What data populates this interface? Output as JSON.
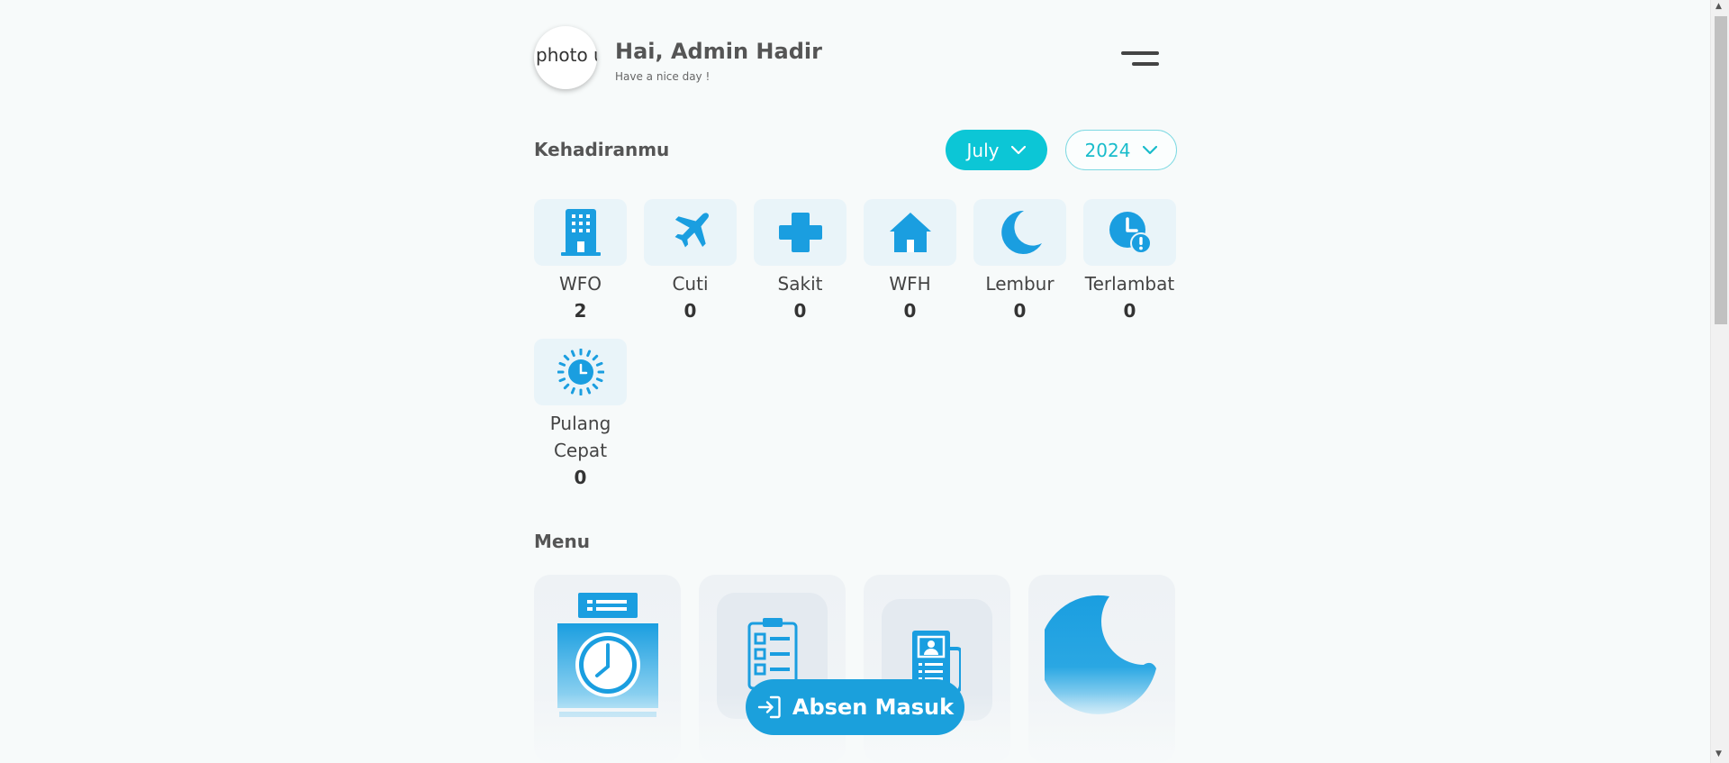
{
  "header": {
    "avatar_alt": "photo user",
    "greeting": "Hai, Admin Hadir",
    "subtitle": "Have a nice day !"
  },
  "attendance": {
    "title": "Kehadiranmu",
    "month": "July",
    "year": "2024",
    "stats": [
      {
        "label": "WFO",
        "value": "2",
        "icon": "office-building-icon"
      },
      {
        "label": "Cuti",
        "value": "0",
        "icon": "airplane-icon"
      },
      {
        "label": "Sakit",
        "value": "0",
        "icon": "medical-cross-icon"
      },
      {
        "label": "WFH",
        "value": "0",
        "icon": "home-icon"
      },
      {
        "label": "Lembur",
        "value": "0",
        "icon": "moon-icon"
      },
      {
        "label": "Terlambat",
        "value": "0",
        "icon": "clock-alert-icon"
      },
      {
        "label": "Pulang Cepat",
        "value": "0",
        "icon": "sun-clock-icon"
      }
    ]
  },
  "menu": {
    "title": "Menu",
    "items": [
      {
        "icon": "time-clock-machine-icon"
      },
      {
        "icon": "clipboard-checklist-icon"
      },
      {
        "icon": "document-profile-icon"
      },
      {
        "icon": "moon-icon"
      }
    ]
  },
  "absen_button": {
    "label": "Absen Masuk",
    "icon": "sign-in-icon"
  },
  "colors": {
    "accent": "#0cc6d6",
    "primary": "#1ba0dc",
    "icon_blue": "#1a9ee0"
  }
}
